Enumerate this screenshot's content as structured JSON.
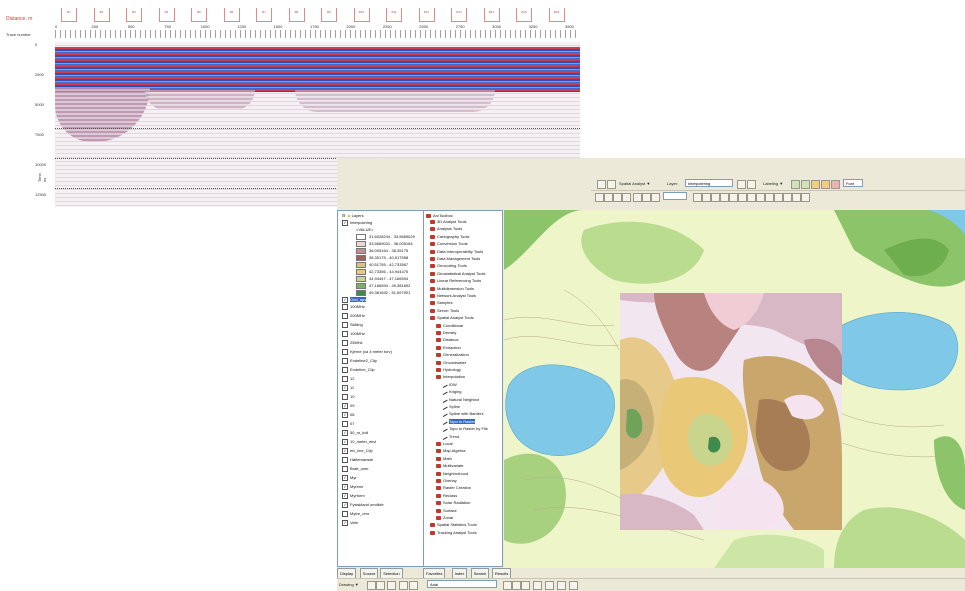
{
  "radar": {
    "title": "Distance, m",
    "ruler_label": "Trace number",
    "x_ticks": [
      "0",
      "250",
      "500",
      "750",
      "1000",
      "1250",
      "1500",
      "1750",
      "2000",
      "2250",
      "2500",
      "2750",
      "3000",
      "3250",
      "3500"
    ],
    "depth_ticks": [
      "0",
      "2500",
      "5000",
      "7500",
      "10000",
      "12500"
    ],
    "depth_axis_label": "Time, ns",
    "markers": [
      "B1",
      "B2",
      "B3",
      "B4",
      "B5",
      "B6",
      "B7",
      "B8",
      "B9",
      "B10",
      "B11",
      "B12",
      "B13",
      "B14",
      "B15",
      "B16"
    ]
  },
  "toolbar": {
    "spatial_analyst_label": "Spatial Analyst ▼",
    "layer_label": "Layer:",
    "layer_value": "Interpolering",
    "labeling_label": "Labeling ▼",
    "font_label": "Font"
  },
  "toc": {
    "root": "Layers",
    "items": [
      {
        "label": "Interpolering",
        "check": true,
        "level": 1
      },
      {
        "label": "<VALUE>",
        "level": 2
      },
      {
        "label": "31,6028244 - 33,5669029",
        "level": 2,
        "swatch": "#ffffff"
      },
      {
        "label": "33,5669031 - 36,005164",
        "level": 2,
        "swatch": "#f0d7d7"
      },
      {
        "label": "36,005164 - 38,35175",
        "level": 2,
        "swatch": "#c98a94"
      },
      {
        "label": "38,35175 - 40,517558",
        "level": 2,
        "swatch": "#a06060"
      },
      {
        "label": "40,51755 - 42,733567",
        "level": 2,
        "swatch": "#d9c08a"
      },
      {
        "label": "42,73356 - 44,944475",
        "level": 2,
        "swatch": "#e9c978"
      },
      {
        "label": "44,94447 - 47,166594",
        "level": 2,
        "swatch": "#c9d48c"
      },
      {
        "label": "47,166594 - 49,381692",
        "level": 2,
        "swatch": "#7fb06a"
      },
      {
        "label": "49,381692 - 51,597901",
        "level": 2,
        "swatch": "#3f8a4d"
      },
      {
        "label": "Grid_aps",
        "check": true,
        "level": 1,
        "selected": true
      },
      {
        "label": "100MHz",
        "check": false,
        "level": 1
      },
      {
        "label": "200MHz",
        "check": false,
        "level": 1
      },
      {
        "label": "Skilling",
        "check": false,
        "level": 1
      },
      {
        "label": "100MHz",
        "check": false,
        "level": 1
      },
      {
        "label": "25MHz",
        "check": false,
        "level": 1
      },
      {
        "label": "Kjerne (ca 4 meter torv)",
        "check": false,
        "level": 1
      },
      {
        "label": "Endeline2_Clip",
        "check": false,
        "level": 1
      },
      {
        "label": "Endeline_Clip",
        "check": false,
        "level": 1
      },
      {
        "label": "12",
        "check": false,
        "level": 1
      },
      {
        "label": "11",
        "check": true,
        "level": 1
      },
      {
        "label": "10",
        "check": false,
        "level": 1
      },
      {
        "label": "09",
        "check": true,
        "level": 1
      },
      {
        "label": "08",
        "check": true,
        "level": 1
      },
      {
        "label": "07",
        "check": false,
        "level": 1
      },
      {
        "label": "50_m_koll",
        "check": true,
        "level": 1
      },
      {
        "label": "10_meter_ekvi",
        "check": true,
        "level": 1
      },
      {
        "label": "elv_line_Clip",
        "check": true,
        "level": 1
      },
      {
        "label": "Høltemarade",
        "check": false,
        "level": 1
      },
      {
        "label": "Bratt_uner",
        "check": false,
        "level": 1
      },
      {
        "label": "Myr",
        "check": true,
        "level": 1
      },
      {
        "label": "Myrene",
        "check": true,
        "level": 1
      },
      {
        "label": "Myrform",
        "check": true,
        "level": 1
      },
      {
        "label": "Fysiskland område",
        "check": true,
        "level": 1
      },
      {
        "label": "Mytre_omr",
        "check": false,
        "level": 1
      },
      {
        "label": "Vatn",
        "check": true,
        "level": 1
      }
    ],
    "tabs": [
      "Display",
      "Source",
      "Selection"
    ]
  },
  "toolbox": {
    "root": "ArcToolbox",
    "items": [
      {
        "label": "3D Analyst Tools",
        "level": 1
      },
      {
        "label": "Analysis Tools",
        "level": 1
      },
      {
        "label": "Cartography Tools",
        "level": 1
      },
      {
        "label": "Conversion Tools",
        "level": 1
      },
      {
        "label": "Data Interoperability Tools",
        "level": 1
      },
      {
        "label": "Data Management Tools",
        "level": 1
      },
      {
        "label": "Geocoding Tools",
        "level": 1
      },
      {
        "label": "Geostatistical Analyst Tools",
        "level": 1
      },
      {
        "label": "Linear Referencing Tools",
        "level": 1
      },
      {
        "label": "Multidimension Tools",
        "level": 1
      },
      {
        "label": "Network Analyst Tools",
        "level": 1
      },
      {
        "label": "Samples",
        "level": 1
      },
      {
        "label": "Server Tools",
        "level": 1
      },
      {
        "label": "Spatial Analyst Tools",
        "level": 1
      },
      {
        "label": "Conditional",
        "level": 2
      },
      {
        "label": "Density",
        "level": 2
      },
      {
        "label": "Distance",
        "level": 2
      },
      {
        "label": "Extraction",
        "level": 2
      },
      {
        "label": "Generalization",
        "level": 2
      },
      {
        "label": "Groundwater",
        "level": 2
      },
      {
        "label": "Hydrology",
        "level": 2
      },
      {
        "label": "Interpolation",
        "level": 2
      },
      {
        "label": "IDW",
        "level": 3
      },
      {
        "label": "Kriging",
        "level": 3
      },
      {
        "label": "Natural Neighbor",
        "level": 3
      },
      {
        "label": "Spline",
        "level": 3
      },
      {
        "label": "Spline with Barriers",
        "level": 3
      },
      {
        "label": "Topo to Raster",
        "level": 3,
        "selected": true
      },
      {
        "label": "Topo to Raster by File",
        "level": 3
      },
      {
        "label": "Trend",
        "level": 3
      },
      {
        "label": "Local",
        "level": 2
      },
      {
        "label": "Map Algebra",
        "level": 2
      },
      {
        "label": "Math",
        "level": 2
      },
      {
        "label": "Multivariate",
        "level": 2
      },
      {
        "label": "Neighborhood",
        "level": 2
      },
      {
        "label": "Overlay",
        "level": 2
      },
      {
        "label": "Raster Creation",
        "level": 2
      },
      {
        "label": "Reclass",
        "level": 2
      },
      {
        "label": "Solar Radiation",
        "level": 2
      },
      {
        "label": "Surface",
        "level": 2
      },
      {
        "label": "Zonal",
        "level": 2
      },
      {
        "label": "Spatial Statistics Tools",
        "level": 1
      },
      {
        "label": "Tracking Analyst Tools",
        "level": 1
      }
    ],
    "tabs": [
      "Favorites",
      "Index",
      "Search",
      "Results"
    ]
  },
  "bottombar": {
    "drawing_label": "Drawing ▼",
    "font_value": "Arial"
  },
  "colors": {
    "radar_red": "#d33c4c",
    "radar_blue": "#2e4fb8",
    "water": "#7fc8e8",
    "forest": "#8cc46a",
    "open_land": "#eef5c9"
  }
}
